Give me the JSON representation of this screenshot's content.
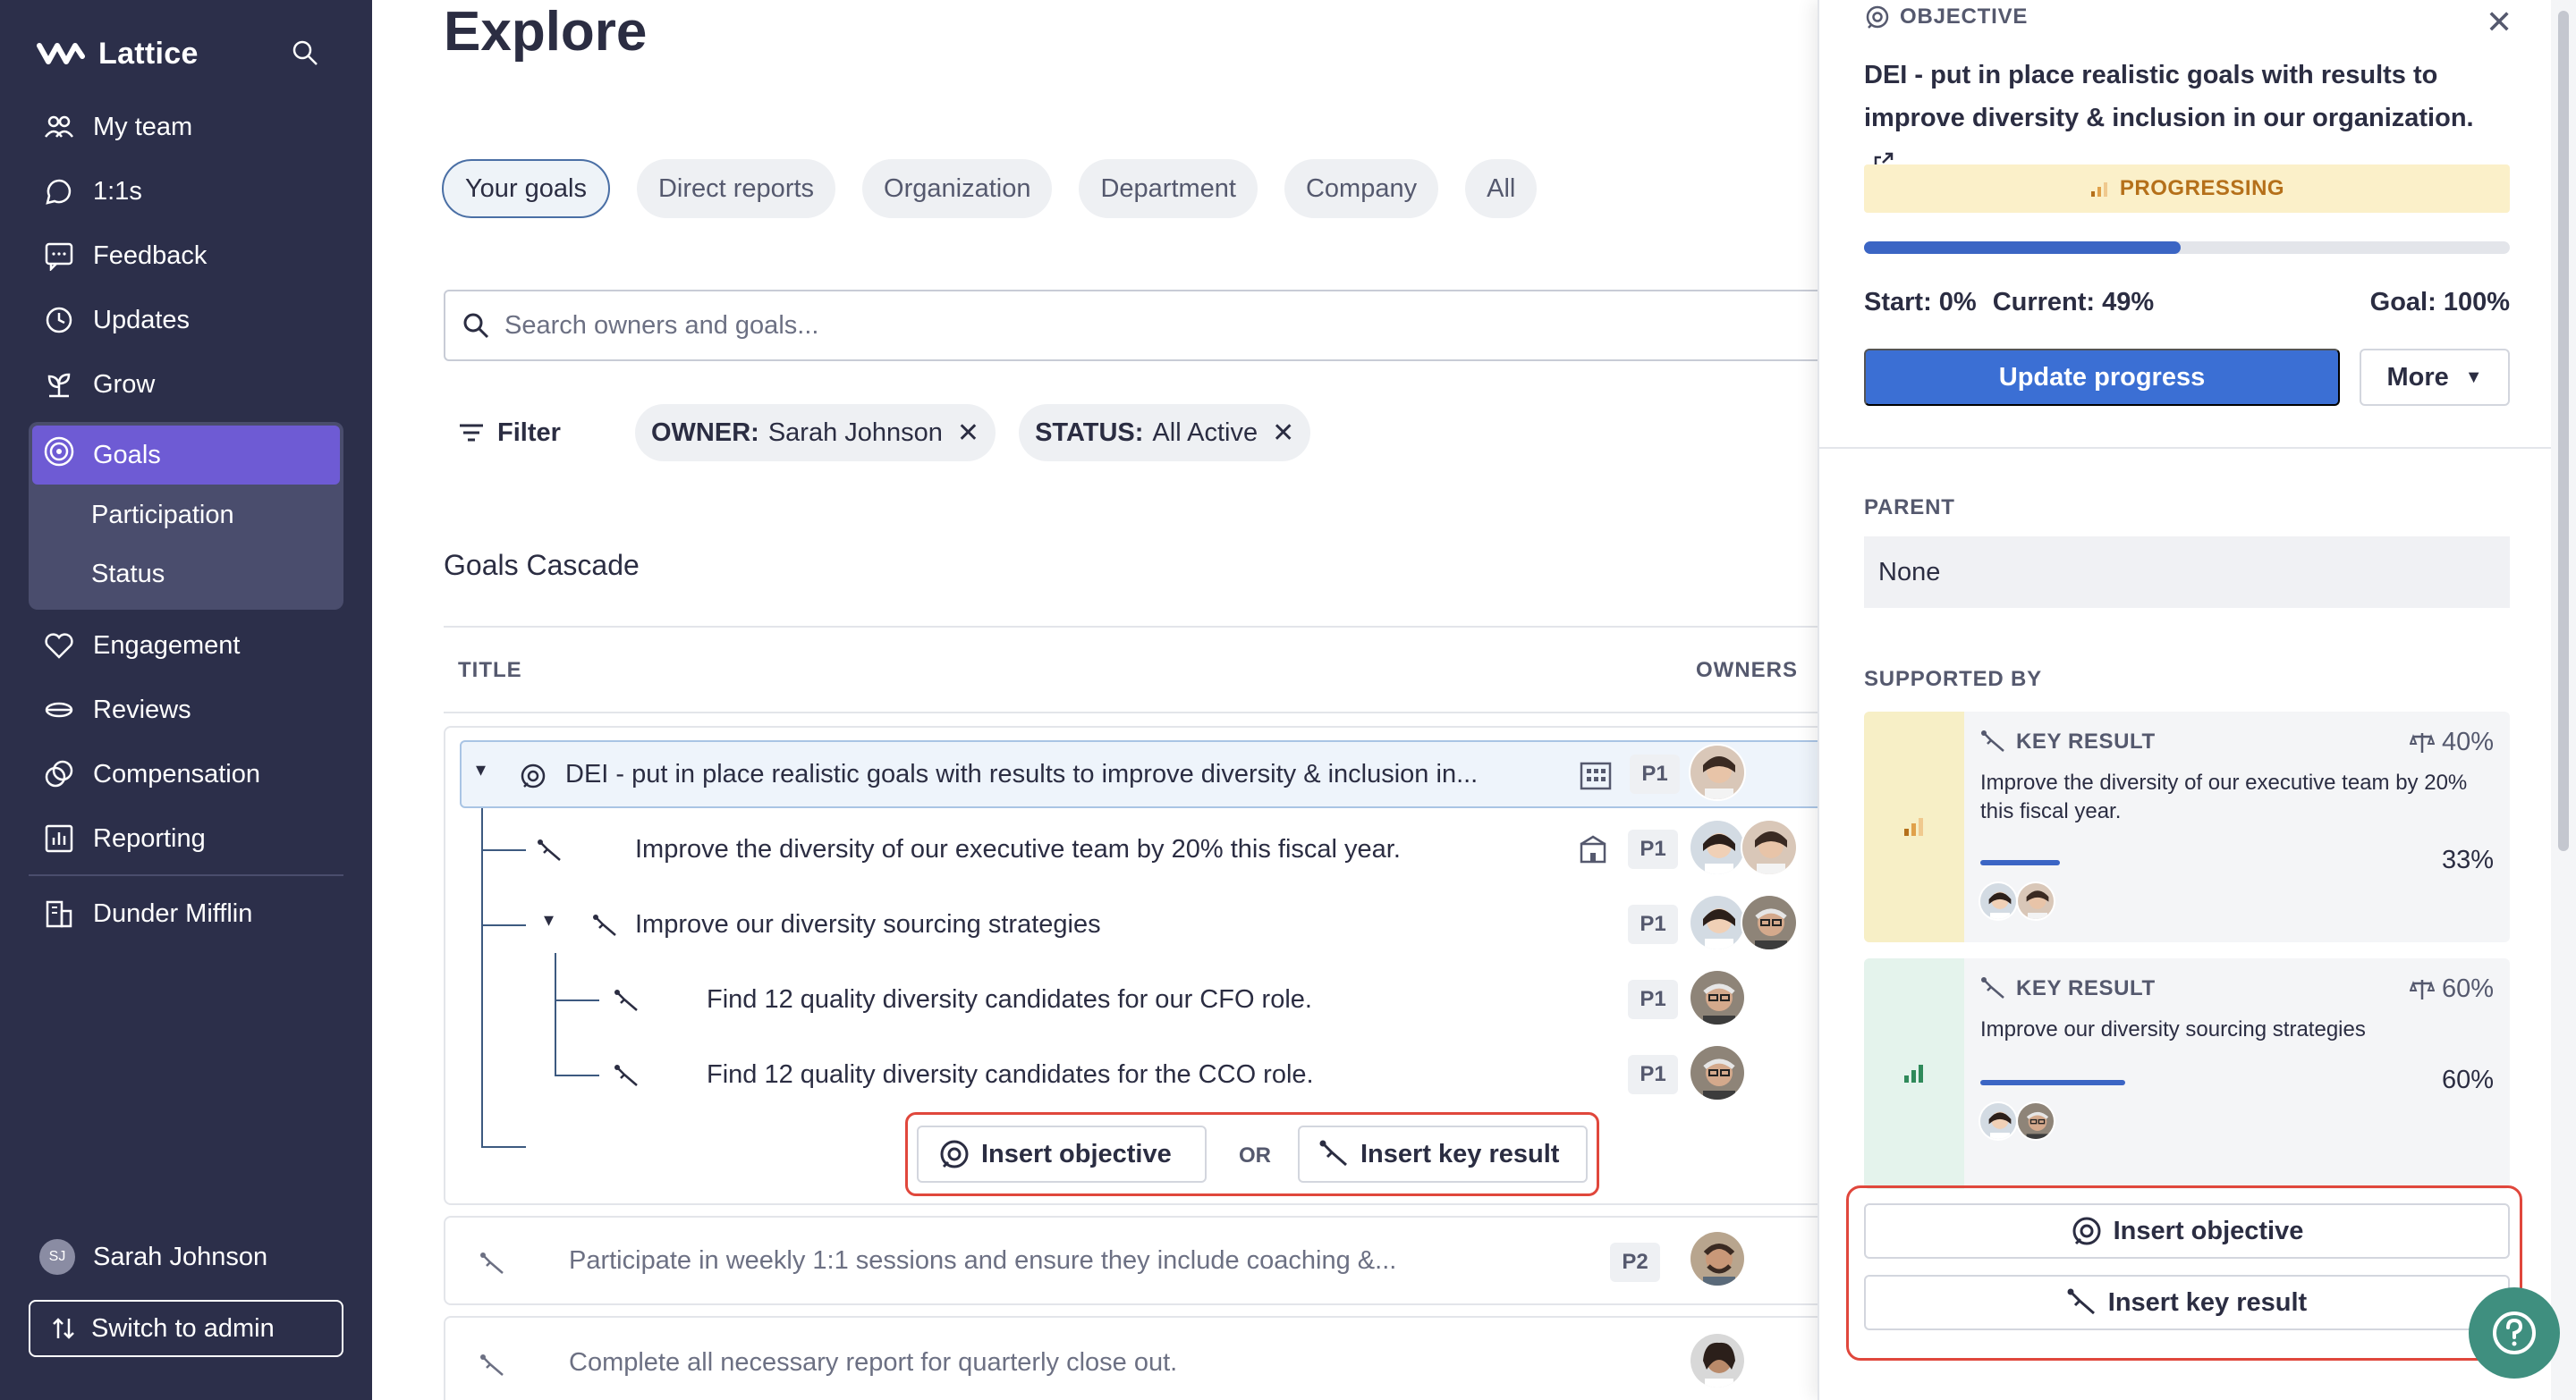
{
  "sidebar": {
    "brand": "Lattice",
    "items": [
      {
        "label": "My team",
        "icon": "team-icon"
      },
      {
        "label": "1:1s",
        "icon": "chat-bubbles-icon"
      },
      {
        "label": "Feedback",
        "icon": "feedback-icon"
      },
      {
        "label": "Updates",
        "icon": "clock-icon"
      },
      {
        "label": "Grow",
        "icon": "sprout-icon"
      },
      {
        "label": "Goals",
        "icon": "target-icon",
        "active": true
      },
      {
        "label": "Engagement",
        "icon": "heart-icon"
      },
      {
        "label": "Reviews",
        "icon": "reviews-icon"
      },
      {
        "label": "Compensation",
        "icon": "coins-icon"
      },
      {
        "label": "Reporting",
        "icon": "chart-icon"
      },
      {
        "label": "Dunder Mifflin",
        "icon": "building-icon"
      }
    ],
    "goals_sub": [
      "Participation",
      "Status"
    ],
    "user": {
      "initials": "SJ",
      "name": "Sarah Johnson"
    },
    "switch_label": "Switch to admin"
  },
  "main": {
    "title": "Explore",
    "tabs": [
      "Your goals",
      "Direct reports",
      "Organization",
      "Department",
      "Company",
      "All"
    ],
    "active_tab": "Your goals",
    "search_placeholder": "Search owners and goals...",
    "filter_label": "Filter",
    "chips": [
      {
        "key": "OWNER:",
        "value": "Sarah Johnson"
      },
      {
        "key": "STATUS:",
        "value": "All Active"
      }
    ],
    "section_title": "Goals Cascade",
    "col_title": "TITLE",
    "col_owners": "OWNERS",
    "rows": [
      {
        "title": "DEI - put in place realistic goals with results to improve diversity & inclusion in...",
        "priority": "P1",
        "type": "objective"
      },
      {
        "title": "Improve the diversity of our executive team by 20% this fiscal year.",
        "priority": "P1",
        "type": "key-result"
      },
      {
        "title": "Improve our diversity sourcing strategies",
        "priority": "P1",
        "type": "key-result"
      },
      {
        "title": "Find 12 quality diversity candidates for our CFO role.",
        "priority": "P1",
        "type": "key-result"
      },
      {
        "title": "Find 12 quality diversity candidates for the CCO role.",
        "priority": "P1",
        "type": "key-result"
      }
    ],
    "insert_objective": "Insert objective",
    "or_label": "OR",
    "insert_key_result": "Insert key result",
    "other_goals": [
      {
        "title": "Participate in weekly 1:1 sessions and ensure they include coaching &...",
        "priority": "P2"
      },
      {
        "title": "Complete all necessary report for quarterly close out.",
        "priority": ""
      }
    ]
  },
  "panel": {
    "type_label": "OBJECTIVE",
    "title": "DEI - put in place realistic goals with results to improve diversity & inclusion in our organization.",
    "status": "PROGRESSING",
    "progress": 0.49,
    "start": "Start: 0%",
    "current": "Current: 49%",
    "goal": "Goal: 100%",
    "update_btn": "Update progress",
    "more_btn": "More",
    "parent_label": "PARENT",
    "parent_value": "None",
    "supported_label": "SUPPORTED BY",
    "key_results": [
      {
        "label": "KEY RESULT",
        "weight": "40%",
        "desc": "Improve the diversity of our executive team by 20% this fiscal year.",
        "pct": "33%",
        "progress": 0.33
      },
      {
        "label": "KEY RESULT",
        "weight": "60%",
        "desc": "Improve our diversity sourcing strategies",
        "pct": "60%",
        "progress": 0.6
      }
    ],
    "insert_objective": "Insert objective",
    "insert_key_result": "Insert key result"
  },
  "colors": {
    "sidebar": "#2c2f4a",
    "accent": "#6e5bd4",
    "primary": "#3b6fd4",
    "highlight": "#e0473c",
    "progressing": "#b5701a"
  }
}
